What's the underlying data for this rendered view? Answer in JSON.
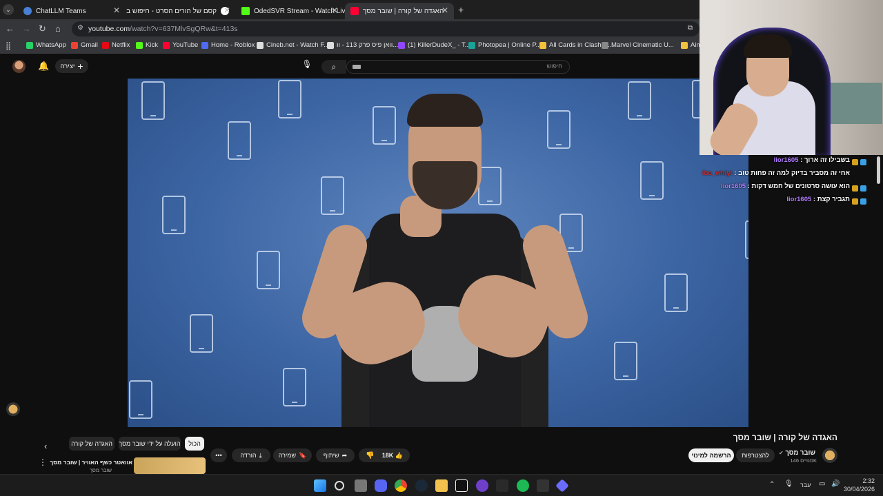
{
  "browser": {
    "tabs": [
      {
        "label": "ChatLLM Teams",
        "icon": "chatllm-icon",
        "color": "#4a7fd6"
      },
      {
        "label": "קסם של הורים הסרט - חיפוש ב",
        "icon": "google-icon",
        "color": "#ffffff"
      },
      {
        "label": "OdedSVR Stream - Watch Live",
        "icon": "kick-icon",
        "color": "#53fc18"
      },
      {
        "label": "האגדה של קורה | שובר מסך",
        "icon": "youtube-icon",
        "color": "#ff0033"
      }
    ],
    "url_main": "youtube.com",
    "url_rest": "/watch?v=637MlvSgQRw&t=413s",
    "bookmarks": [
      {
        "label": "WhatsApp",
        "color": "#25d366"
      },
      {
        "label": "Gmail",
        "color": "#ea4335"
      },
      {
        "label": "Netflix",
        "color": "#e50914"
      },
      {
        "label": "Kick",
        "color": "#53fc18"
      },
      {
        "label": "YouTube",
        "color": "#ff0033"
      },
      {
        "label": "Home - Roblox",
        "color": "#4f6bf0"
      },
      {
        "label": "Cineb.net - Watch F...",
        "color": "#dddddd"
      },
      {
        "label": "וואן פיס פרק 113 - וו...",
        "color": "#dddddd"
      },
      {
        "label": "(1) KillerDudeX_ - T...",
        "color": "#9146ff"
      },
      {
        "label": "Photopea | Online P...",
        "color": "#18a497"
      },
      {
        "label": "All Cards in Clash R...",
        "color": "#f5c13b"
      },
      {
        "label": "Marvel Cinematic U...",
        "color": "#888888"
      },
      {
        "label": "Aim",
        "color": "#f0c040"
      }
    ]
  },
  "youtube": {
    "create_label": "יצירה",
    "search_placeholder": "חיפוש",
    "video_title": "האגדה של קורה | שובר מסך",
    "channel_name": "שובר מסך",
    "subscribers": "146K",
    "subscribers_unit": "מנויים",
    "join_label": "להצטרפות",
    "subscribe_label": "הרשמה למינוי",
    "likes": "18K",
    "share_label": "שיתוף",
    "save_label": "שמירה",
    "download_label": "הורדה",
    "chips": [
      "הכול",
      "הועלה על ידי שובר מסך",
      "האגדה של קורה"
    ],
    "related_title": "אוואטר כשף האוויר | שובר מסך",
    "related_channel": "שובר מסך"
  },
  "chat": [
    {
      "user": "lior1605",
      "message": "בשבילו זה ארוך"
    },
    {
      "user": "ibo_whiyt",
      "message": "אחי זה מסביר בדיוק למה זה פחות טוב"
    },
    {
      "user": "lior1605",
      "message": "הוא עושה סרטונים של חמש דקות"
    },
    {
      "user": "lior1605",
      "message": "תגביר קצת"
    }
  ],
  "taskbar": {
    "language": "עבר",
    "time": "2:32",
    "date": "30/04/2026"
  }
}
